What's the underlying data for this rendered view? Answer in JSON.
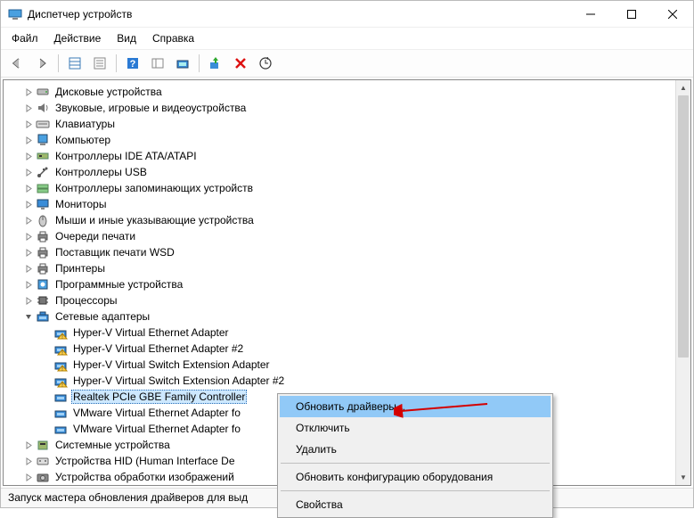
{
  "window": {
    "title": "Диспетчер устройств"
  },
  "menubar": {
    "file": "Файл",
    "action": "Действие",
    "view": "Вид",
    "help": "Справка"
  },
  "tree": {
    "items": [
      {
        "level": 0,
        "exp": "closed",
        "icon": "disk",
        "label": "Дисковые устройства"
      },
      {
        "level": 0,
        "exp": "closed",
        "icon": "sound",
        "label": "Звуковые, игровые и видеоустройства"
      },
      {
        "level": 0,
        "exp": "closed",
        "icon": "keyboard",
        "label": "Клавиатуры"
      },
      {
        "level": 0,
        "exp": "closed",
        "icon": "pc",
        "label": "Компьютер"
      },
      {
        "level": 0,
        "exp": "closed",
        "icon": "ide",
        "label": "Контроллеры IDE ATA/ATAPI"
      },
      {
        "level": 0,
        "exp": "closed",
        "icon": "usb",
        "label": "Контроллеры USB"
      },
      {
        "level": 0,
        "exp": "closed",
        "icon": "storage",
        "label": "Контроллеры запоминающих устройств"
      },
      {
        "level": 0,
        "exp": "closed",
        "icon": "monitor",
        "label": "Мониторы"
      },
      {
        "level": 0,
        "exp": "closed",
        "icon": "mouse",
        "label": "Мыши и иные указывающие устройства"
      },
      {
        "level": 0,
        "exp": "closed",
        "icon": "printer",
        "label": "Очереди печати"
      },
      {
        "level": 0,
        "exp": "closed",
        "icon": "printer",
        "label": "Поставщик печати WSD"
      },
      {
        "level": 0,
        "exp": "closed",
        "icon": "printer",
        "label": "Принтеры"
      },
      {
        "level": 0,
        "exp": "closed",
        "icon": "software",
        "label": "Программные устройства"
      },
      {
        "level": 0,
        "exp": "closed",
        "icon": "cpu",
        "label": "Процессоры"
      },
      {
        "level": 0,
        "exp": "open",
        "icon": "network",
        "label": "Сетевые адаптеры"
      },
      {
        "level": 1,
        "exp": "none",
        "icon": "netwarn",
        "label": "Hyper-V Virtual Ethernet Adapter"
      },
      {
        "level": 1,
        "exp": "none",
        "icon": "netwarn",
        "label": "Hyper-V Virtual Ethernet Adapter #2"
      },
      {
        "level": 1,
        "exp": "none",
        "icon": "netwarn",
        "label": "Hyper-V Virtual Switch Extension Adapter"
      },
      {
        "level": 1,
        "exp": "none",
        "icon": "netwarn",
        "label": "Hyper-V Virtual Switch Extension Adapter #2"
      },
      {
        "level": 1,
        "exp": "none",
        "icon": "net",
        "label": "Realtek PCIe GBE Family Controller",
        "selected": true
      },
      {
        "level": 1,
        "exp": "none",
        "icon": "net",
        "label": "VMware Virtual Ethernet Adapter fo",
        "cut": true
      },
      {
        "level": 1,
        "exp": "none",
        "icon": "net",
        "label": "VMware Virtual Ethernet Adapter fo",
        "cut": true
      },
      {
        "level": 0,
        "exp": "closed",
        "icon": "system",
        "label": "Системные устройства"
      },
      {
        "level": 0,
        "exp": "closed",
        "icon": "hid",
        "label": "Устройства HID (Human Interface De",
        "cut": true
      },
      {
        "level": 0,
        "exp": "closed",
        "icon": "imaging",
        "label": "Устройства обработки изображений",
        "cut": true
      }
    ]
  },
  "context_menu": {
    "update": "Обновить драйверы...",
    "disable": "Отключить",
    "delete": "Удалить",
    "rescan": "Обновить конфигурацию оборудования",
    "properties": "Свойства"
  },
  "statusbar": {
    "text": "Запуск мастера обновления драйверов для выд"
  }
}
